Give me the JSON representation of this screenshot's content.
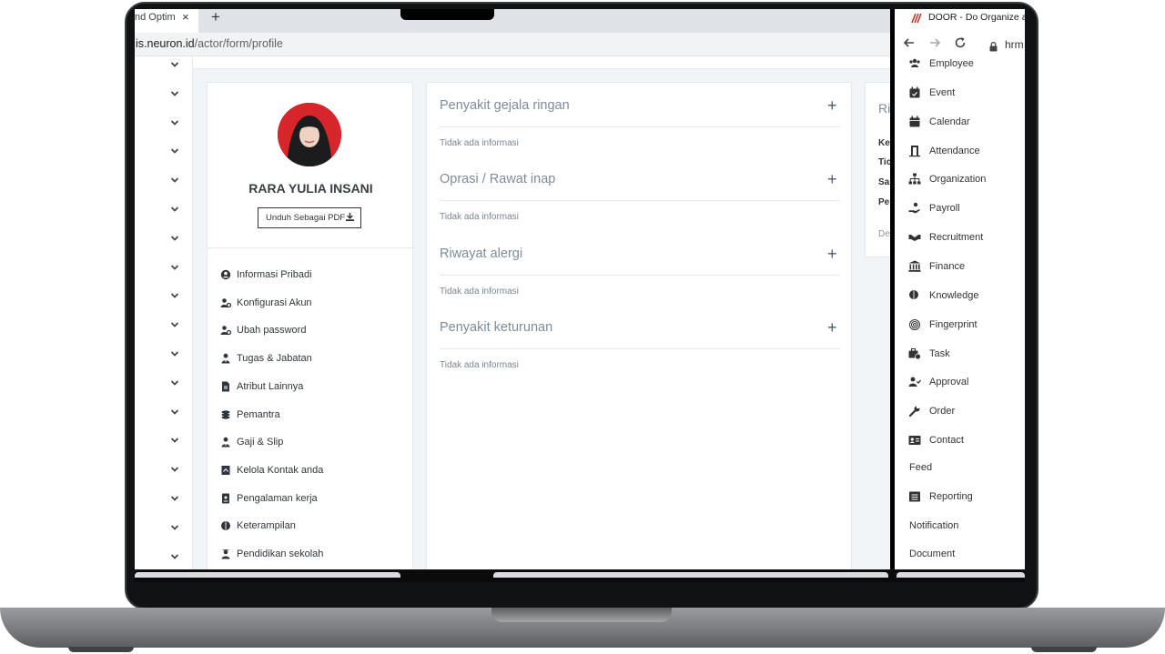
{
  "left_window": {
    "tab_title": "nd Optim",
    "tab_close": "×",
    "new_tab": "+",
    "address_host": "is.neuron.id",
    "address_path": "/actor/form/profile"
  },
  "profile": {
    "name": "RARA YULIA INSANI",
    "pdf_button": "Unduh Sebagai PDF",
    "menu": [
      {
        "label": "Informasi Pribadi",
        "icon": "user-circle-icon"
      },
      {
        "label": "Konfigurasi Akun",
        "icon": "user-cog-icon"
      },
      {
        "label": "Ubah password",
        "icon": "user-key-icon"
      },
      {
        "label": "Tugas & Jabatan",
        "icon": "user-tie-icon"
      },
      {
        "label": "Atribut Lainnya",
        "icon": "file-icon"
      },
      {
        "label": "Pemantra",
        "icon": "coins-icon"
      },
      {
        "label": "Gaji & Slip",
        "icon": "user-tie-icon"
      },
      {
        "label": "Kelola Kontak anda",
        "icon": "contact-book-icon"
      },
      {
        "label": "Pengalaman kerja",
        "icon": "id-badge-icon"
      },
      {
        "label": "Keterampilan",
        "icon": "brain-icon"
      },
      {
        "label": "Pendidikan sekolah",
        "icon": "graduate-icon"
      }
    ]
  },
  "health": {
    "sections": [
      {
        "title": "Penyakit gejala ringan",
        "empty": "Tidak ada informasi"
      },
      {
        "title": "Oprasi / Rawat inap",
        "empty": "Tidak ada informasi"
      },
      {
        "title": "Riwayat alergi",
        "empty": "Tidak ada informasi"
      },
      {
        "title": "Penyakit keturunan",
        "empty": "Tidak ada informasi"
      }
    ],
    "plus": "+"
  },
  "right_card": {
    "title": "Ri",
    "lines": [
      "Ke",
      "Tic",
      "Sa",
      "Pe"
    ],
    "footer": "De"
  },
  "right_window": {
    "tab_title": "DOOR - Do Organize a",
    "url": "hrm",
    "nav": [
      {
        "label": "Employee",
        "icon": "users-icon"
      },
      {
        "label": "Event",
        "icon": "calendar-check-icon"
      },
      {
        "label": "Calendar",
        "icon": "calendar-icon"
      },
      {
        "label": "Attendance",
        "icon": "door-icon"
      },
      {
        "label": "Organization",
        "icon": "sitemap-icon"
      },
      {
        "label": "Payroll",
        "icon": "hand-coin-icon"
      },
      {
        "label": "Recruitment",
        "icon": "handshake-icon"
      },
      {
        "label": "Finance",
        "icon": "bank-icon"
      },
      {
        "label": "Knowledge",
        "icon": "brain-icon"
      },
      {
        "label": "Fingerprint",
        "icon": "fingerprint-icon"
      },
      {
        "label": "Task",
        "icon": "briefcase-clock-icon"
      },
      {
        "label": "Approval",
        "icon": "user-check-icon"
      },
      {
        "label": "Order",
        "icon": "wrench-icon"
      },
      {
        "label": "Contact",
        "icon": "address-card-icon"
      }
    ],
    "feed": "Feed",
    "reporting": {
      "label": "Reporting",
      "icon": "list-alt-icon"
    },
    "notification": "Notification",
    "document": "Document"
  },
  "colors": {
    "accent_red": "#d6262b",
    "section_title": "#7e8c9a",
    "page_bg": "#f2f5f8"
  }
}
